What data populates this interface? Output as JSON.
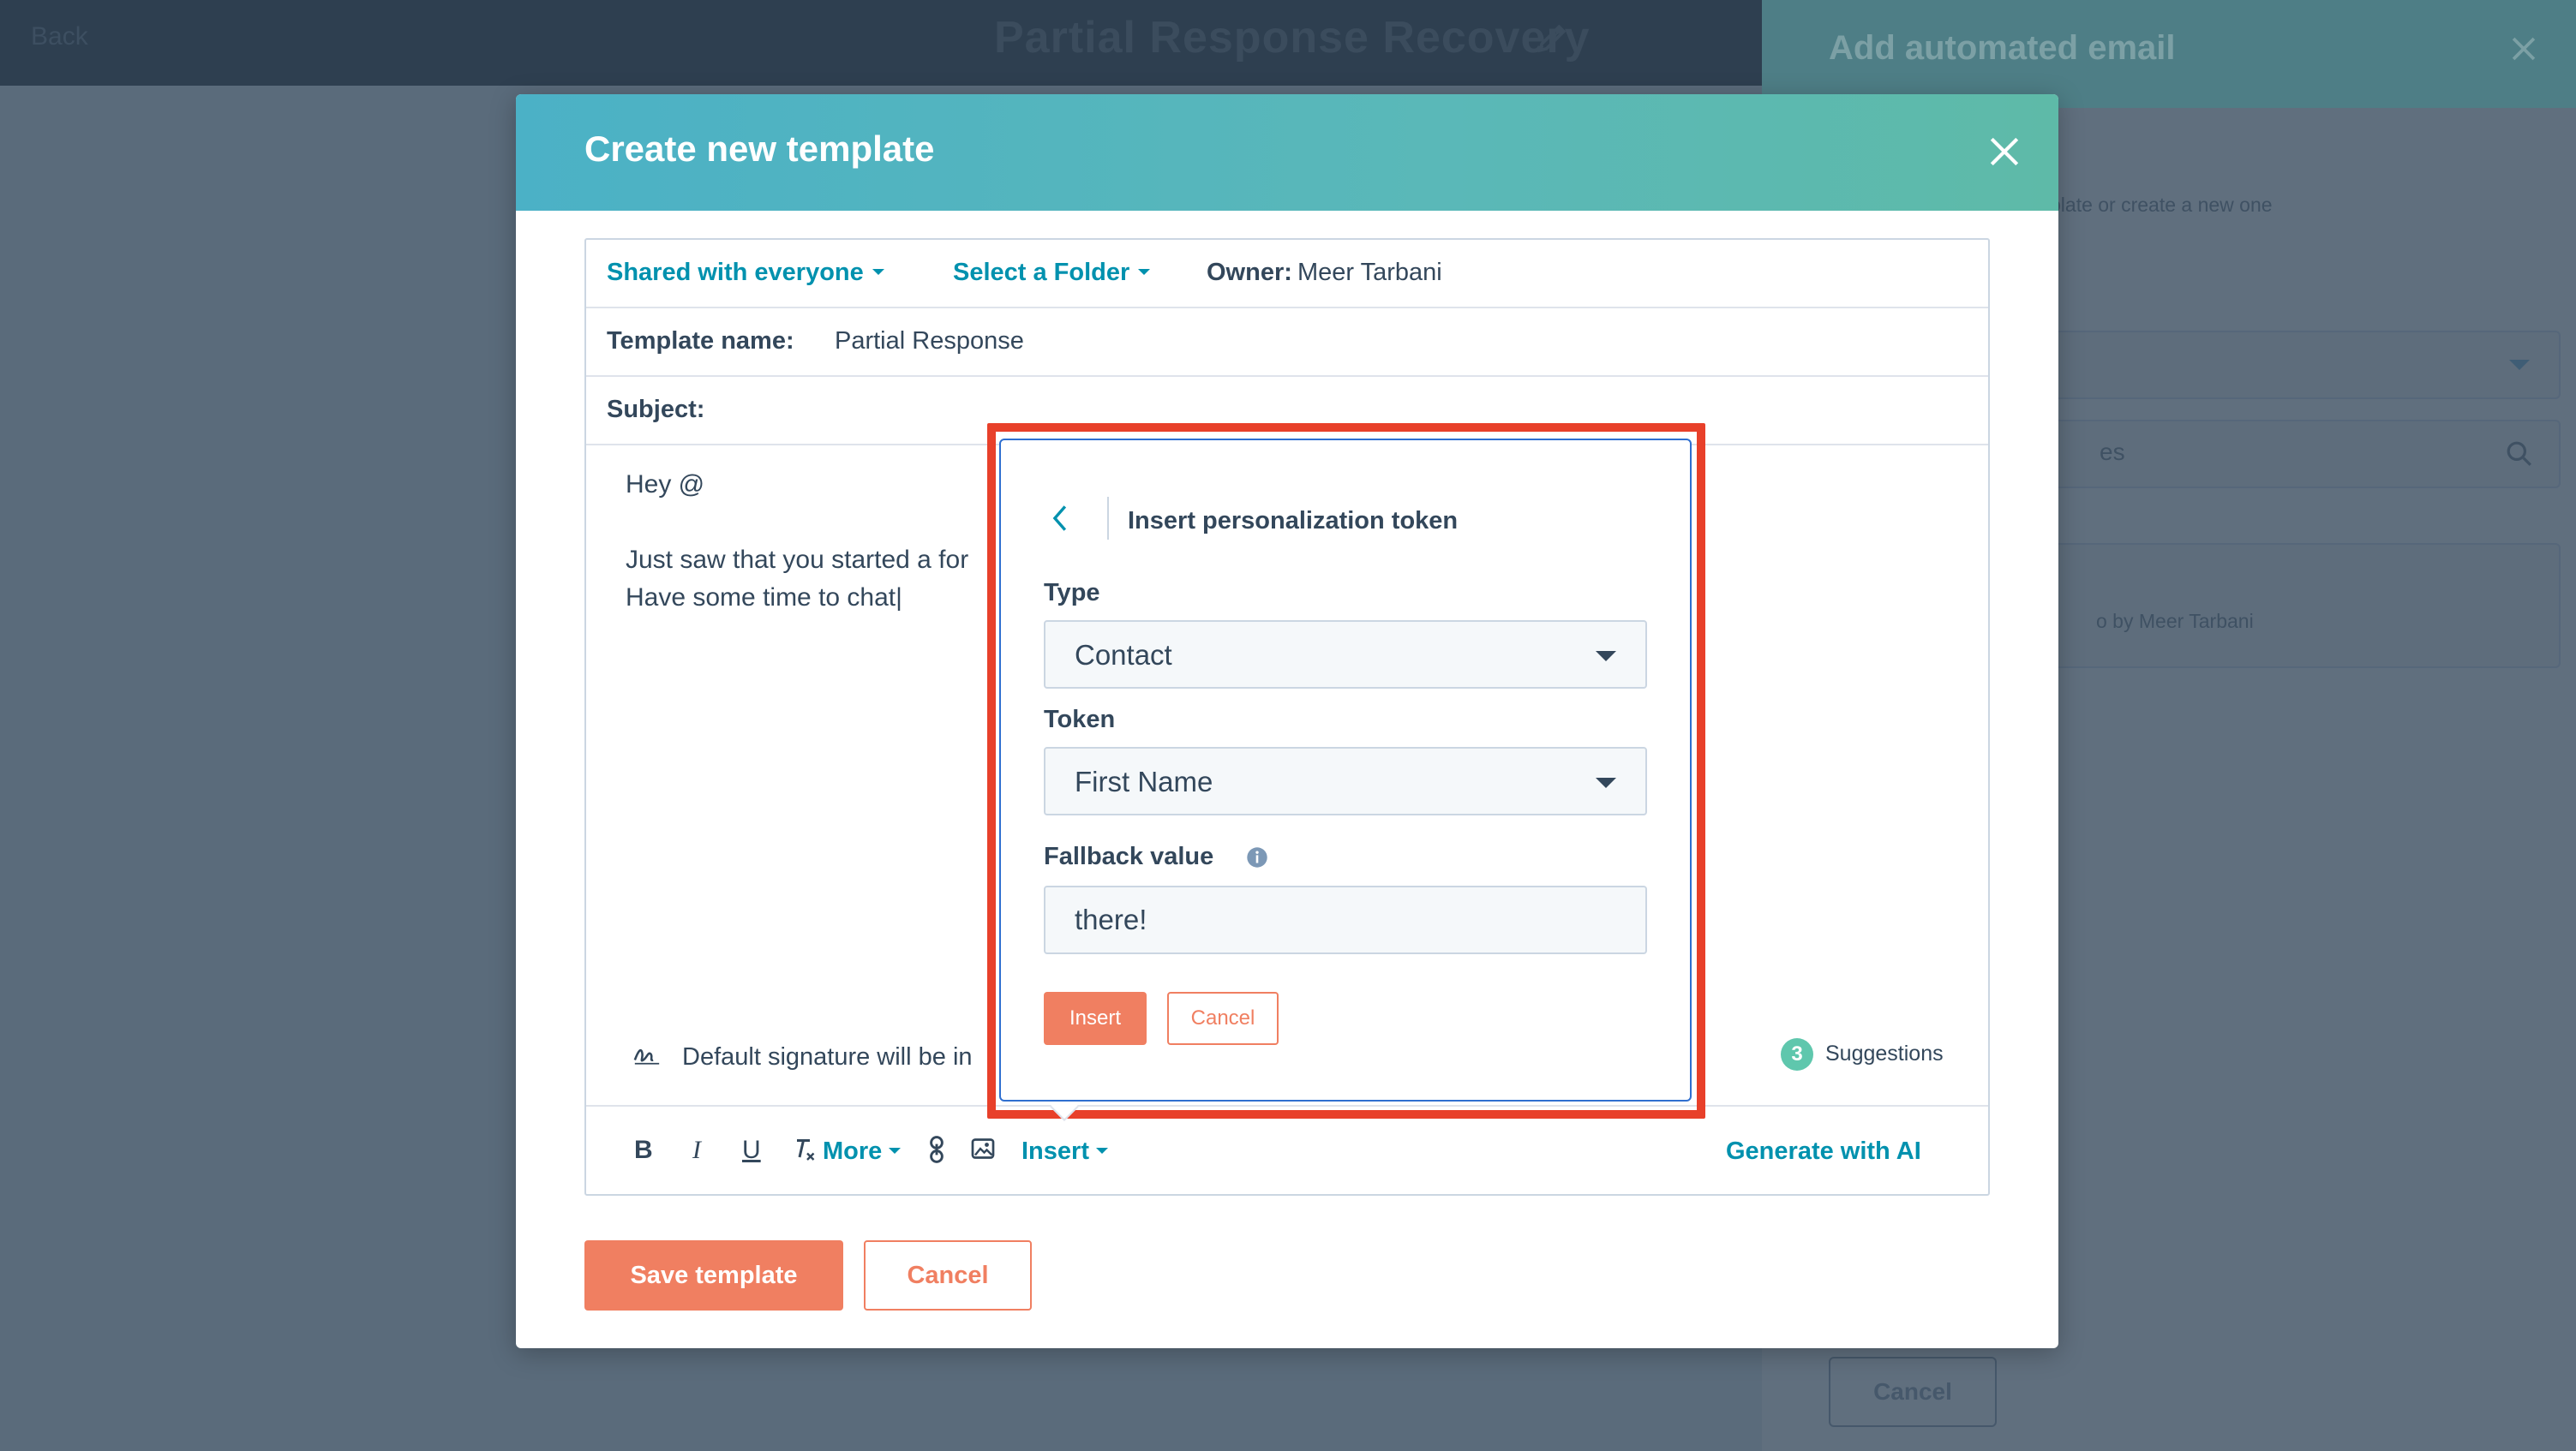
{
  "background": {
    "back_label": "Back",
    "page_title": "Partial Response Recovery",
    "panel": {
      "title": "Add automated email",
      "hint": "plate or create a new one",
      "search_placeholder": "es",
      "card_meta": "o by Meer Tarbani",
      "cancel_label": "Cancel"
    }
  },
  "modal": {
    "title": "Create new template",
    "sharing_label": "Shared with everyone",
    "folder_label": "Select a Folder",
    "owner_label": "Owner:",
    "owner_value": "Meer Tarbani",
    "template_name_label": "Template name:",
    "template_name_value": "Partial Response",
    "subject_label": "Subject:",
    "subject_value": "",
    "body_lines": [
      "Hey @",
      "Just saw that you started a for",
      "Have some time to chat|"
    ],
    "signature_text": "Default signature will be in",
    "suggestions_count": "3",
    "suggestions_label": "Suggestions",
    "toolbar": {
      "bold": "B",
      "italic": "I",
      "underline": "U",
      "clear_format": "T",
      "more_label": "More",
      "insert_label": "Insert",
      "ai_label": "Generate with AI"
    },
    "save_label": "Save template",
    "cancel_label": "Cancel"
  },
  "token_popover": {
    "title": "Insert personalization token",
    "type_label": "Type",
    "type_value": "Contact",
    "token_label": "Token",
    "token_value": "First Name",
    "fallback_label": "Fallback value",
    "fallback_value": "there!",
    "insert_label": "Insert",
    "cancel_label": "Cancel"
  },
  "colors": {
    "accent_orange": "#f07f61",
    "link_teal": "#0091ae",
    "header_gradient_start": "#4bb1c6",
    "header_gradient_end": "#5ebaa8",
    "highlight_red": "#e8402a",
    "text_dark": "#33475b"
  }
}
